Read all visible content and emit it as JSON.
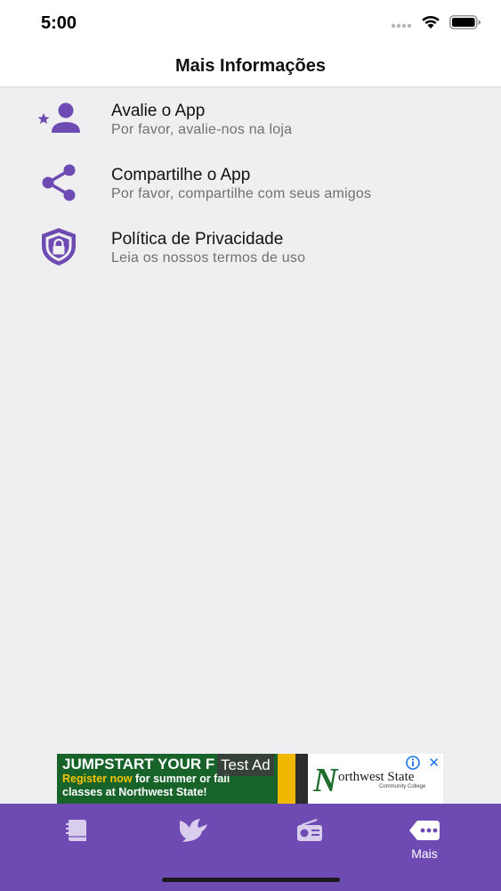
{
  "status_bar": {
    "time": "5:00",
    "icons": [
      "signal-dots-icon",
      "wifi-icon",
      "battery-icon"
    ]
  },
  "header": {
    "title": "Mais Informações"
  },
  "items": [
    {
      "icon": "rate-person-star-icon",
      "title": "Avalie o App",
      "subtitle": "Por favor, avalie-nos na loja"
    },
    {
      "icon": "share-icon",
      "title": "Compartilhe o App",
      "subtitle": "Por favor, compartilhe com seus amigos"
    },
    {
      "icon": "privacy-shield-lock-icon",
      "title": "Política de Privacidade",
      "subtitle": "Leia os nossos termos de uso"
    }
  ],
  "ad": {
    "label": "Test Ad",
    "headline": "JUMPSTART YOUR F",
    "line1_highlight": "Register now",
    "line1_rest": " for summer or fall",
    "line2": "classes at Northwest State!",
    "brand": "orthwest State",
    "brand_sub": "Community College"
  },
  "tab_bar": {
    "tabs": [
      {
        "icon": "book-icon",
        "label": ""
      },
      {
        "icon": "dove-icon",
        "label": ""
      },
      {
        "icon": "radio-icon",
        "label": ""
      },
      {
        "icon": "more-icon",
        "label": "Mais"
      }
    ],
    "active_index": 3
  },
  "colors": {
    "accent": "#6e4bb3",
    "background": "#efeef1",
    "header_bg": "#ffffff"
  }
}
